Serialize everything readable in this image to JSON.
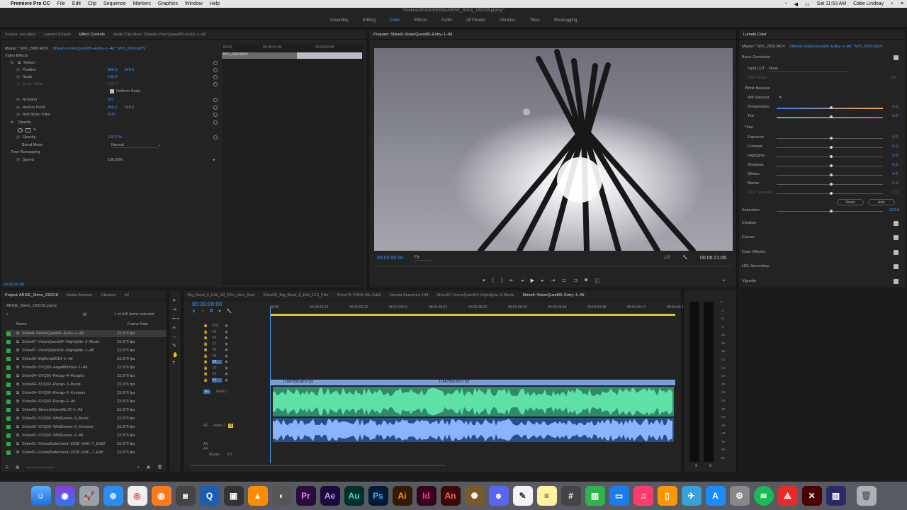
{
  "menubar": {
    "app_name": "Premiere Pro CC",
    "items": [
      "File",
      "Edit",
      "Clip",
      "Sequence",
      "Markers",
      "Graphics",
      "Window",
      "Help"
    ],
    "clock": "Sat 11:53 AM",
    "user": "Cabe Lindsay"
  },
  "window_title": "/Volumes/EAGLE/Edits/ARISE_Shine_190218.prproj *",
  "workspaces": {
    "items": [
      "Assembly",
      "Editing",
      "Color",
      "Effects",
      "Audio",
      "All Panels",
      "Libraries",
      "Titles",
      "Metalogging"
    ],
    "active": "Color"
  },
  "effect_controls": {
    "tabs": [
      "Source: (no clips)",
      "Lumetri Scopes",
      "Effect Controls",
      "Audio Clip Mixer: Shine8–VisionQuest05–Entry–1–All"
    ],
    "active_tab": "Effect Controls",
    "master": "Master * MVI_2669.MOV",
    "sequence_clip": "Shine8–VisionQuest05–Entry–1–All * MVI_2669.MOV",
    "video_effects": "Video Effects",
    "motion": "Motion",
    "position_label": "Position",
    "position_x": "960.0",
    "position_y": "540.0",
    "scale_label": "Scale",
    "scale_value": "100.0",
    "scale_width_label": "Scale Width",
    "scale_width_value": "100.0",
    "uniform_scale": "Uniform Scale",
    "rotation_label": "Rotation",
    "rotation_value": "0.0",
    "anchor_label": "Anchor Point",
    "anchor_x": "960.0",
    "anchor_y": "540.0",
    "antiflicker_label": "Anti-flicker Filter",
    "antiflicker_value": "0.00",
    "opacity_group": "Opacity",
    "opacity_label": "Opacity",
    "opacity_value": "100.0 %",
    "blend_label": "Blend Mode",
    "blend_value": "Normal",
    "time_remap": "Time Remapping",
    "speed_label": "Speed",
    "speed_value": "100.00%",
    "mini_times": [
      "00:00",
      "00:00:01:00",
      "00:00:02:00"
    ],
    "mini_clip": "MVI_2669.MOV",
    "timecode": "00:00:00:00"
  },
  "program": {
    "title": "Program: Shine8–VisionQuest05–Entry–1–All",
    "timecode": "00:00:00:00",
    "fit": "Fit",
    "resolution": "1/2",
    "duration": "00:05:21:06"
  },
  "lumetri": {
    "title": "Lumetri Color",
    "master": "Master * MVI_2669.MOV",
    "clip": "Shine8–VisionQuest05–Entry–1–All * MVI_2669.MOV",
    "basic": "Basic Correction",
    "input_lut_label": "Input LUT",
    "input_lut_value": "None",
    "hdr_white_label": "HDR White",
    "hdr_white_value": "100",
    "white_balance": "White Balance",
    "wb_selector": "WB Selector",
    "temperature_label": "Temperature",
    "temperature_value": "0.0",
    "tint_label": "Tint",
    "tint_value": "0.0",
    "tone": "Tone",
    "tone_rows": [
      {
        "label": "Exposure",
        "value": "0.0"
      },
      {
        "label": "Contrast",
        "value": "0.0"
      },
      {
        "label": "Highlights",
        "value": "0.0"
      },
      {
        "label": "Shadows",
        "value": "0.0"
      },
      {
        "label": "Whites",
        "value": "0.0"
      },
      {
        "label": "Blacks",
        "value": "0.0"
      },
      {
        "label": "HDR Specular",
        "value": "0.0"
      }
    ],
    "reset": "Reset",
    "auto": "Auto",
    "saturation_label": "Saturation",
    "saturation_value": "100.0",
    "sections": [
      "Creative",
      "Curves",
      "Color Wheels",
      "HSL Secondary",
      "Vignette"
    ]
  },
  "project": {
    "tabs": [
      "Project: ARISE_Shine_190218",
      "Media Browser",
      "Libraries",
      "Inf"
    ],
    "file": "ARISE_Shine_190218.prproj",
    "selected_count": "1 of 445 items selected",
    "col_name": "Name",
    "col_rate": "Frame Rate",
    "items": [
      {
        "name": "Shine8–VisionQuest05–Entry–1–All",
        "rate": "23.976 fps"
      },
      {
        "name": "Shine97–VisionQuest04–Highlights–3–Bests",
        "rate": "23.976 fps"
      },
      {
        "name": "Shine97–VisionQuest04–Highlights–1–All",
        "rate": "23.976 fps"
      },
      {
        "name": "Shine96–BigBend2018–1–All",
        "rate": "23.976 fps"
      },
      {
        "name": "Shine95–SVQ03–AngelMichael–1–All",
        "rate": "23.976 fps"
      },
      {
        "name": "Shine94–SVQ02–Recap–4–Roughs",
        "rate": "23.976 fps"
      },
      {
        "name": "Shine94–SVQ02–Recap–3–Bests",
        "rate": "23.976 fps"
      },
      {
        "name": "Shine94–SVQ02–Recap–2–Keepers",
        "rate": "23.976 fps"
      },
      {
        "name": "Shine94–SVQ02–Recap–1–All",
        "rate": "23.976 fps"
      },
      {
        "name": "Shine93–SteemitOpenMic72–1–All",
        "rate": "23.976 fps"
      },
      {
        "name": "Shine92–SVQ02–WildGoose–3_Bests",
        "rate": "23.976 fps"
      },
      {
        "name": "Shine92–SVQ02–WildGoose–2_Keepers",
        "rate": "23.976 fps"
      },
      {
        "name": "Shine92–SVQ02–WildGoose–1–All",
        "rate": "23.976 fps"
      },
      {
        "name": "Shine91–GlobalSisterhood–2018–VidC–7_Edit2",
        "rate": "23.976 fps"
      },
      {
        "name": "Shine91–GlobalSisterhood–2018–VidC–7_Edit",
        "rate": "23.976 fps"
      }
    ]
  },
  "timeline": {
    "tabs": [
      "Big_Bend_6_Edit_1D_Film_Vem_Aqui",
      "Shine02_Big_Bend_6_Edit_1C3_Film",
      "Shine79–TWIA–8A–Edit2",
      "Nested Sequence 149",
      "Shine97–VisionQuest04–Highlights–3–Bests",
      "Shine8–VisionQuest05–Entry–1–All"
    ],
    "active_tab": "Shine8–VisionQuest05–Entry–1–All",
    "timecode": "00:00:00:00",
    "ruler": [
      "00:00",
      "00:00:29:23",
      "00:00:59:22",
      "00:01:29:21",
      "00:01:59:21",
      "00:02:29:20",
      "00:02:59:19",
      "00:03:29:18",
      "00:03:59:18",
      "00:04:29:17",
      "00:04:59:16"
    ],
    "video_tracks": [
      "V10",
      "V9",
      "V8",
      "V7",
      "V6",
      "V5",
      "V4",
      "V3",
      "V2",
      "V1"
    ],
    "audio_tracks": [
      "A1",
      "A2",
      "A3",
      "A4"
    ],
    "audio1_name": "Audio 1",
    "audio2_name": "Audio 2",
    "master": "Master",
    "master_value": "0.0",
    "clip1": "1L9A7558.MOV [V]",
    "clip2": "1L9A7558.MOV [V]"
  },
  "meter_ticks": [
    "0",
    "-3",
    "-6",
    "-9",
    "-12",
    "-15",
    "-18",
    "-21",
    "-24",
    "-27",
    "-30",
    "-33",
    "-36",
    "-39",
    "-42",
    "-45",
    "-48",
    "-51",
    "-54",
    "dB"
  ],
  "meter_bottom": [
    "S",
    "S"
  ],
  "dock_icons": [
    "finder-icon",
    "siri-icon",
    "launchpad-icon",
    "safari-icon",
    "chrome-icon",
    "firefox-icon",
    "camera-icon",
    "quicktime-icon",
    "finalcut-icon",
    "vlc-icon",
    "compressor-icon",
    "Pr",
    "Ae",
    "Au",
    "Ps",
    "Ai",
    "Id",
    "An",
    "app-icon",
    "discord-icon",
    "textedit-icon",
    "notes-icon",
    "calculator-icon",
    "numbers-icon",
    "keynote-icon",
    "itunes-icon",
    "ibooks-icon",
    "network-icon",
    "appstore-icon",
    "preferences-icon",
    "spotify-icon",
    "acrobat-icon",
    "acrobat-dc-icon",
    "screen-icon",
    "trash-icon"
  ]
}
